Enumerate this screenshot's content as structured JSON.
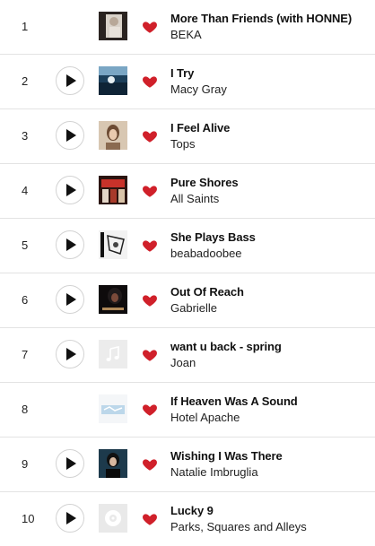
{
  "colors": {
    "heart": "#d0202a",
    "divider": "#e3e3e3",
    "text": "#111111"
  },
  "tracks": [
    {
      "rank": "1",
      "title": "More Than Friends (with HONNE)",
      "artist": "BEKA",
      "has_play": false,
      "art_icon": "album-art-icon"
    },
    {
      "rank": "2",
      "title": "I Try",
      "artist": "Macy Gray",
      "has_play": true,
      "art_icon": "album-art-icon"
    },
    {
      "rank": "3",
      "title": "I Feel Alive",
      "artist": "Tops",
      "has_play": true,
      "art_icon": "album-art-icon"
    },
    {
      "rank": "4",
      "title": "Pure Shores",
      "artist": "All Saints",
      "has_play": true,
      "art_icon": "album-art-icon"
    },
    {
      "rank": "5",
      "title": "She Plays Bass",
      "artist": "beabadoobee",
      "has_play": true,
      "art_icon": "album-art-icon"
    },
    {
      "rank": "6",
      "title": "Out Of Reach",
      "artist": "Gabrielle",
      "has_play": true,
      "art_icon": "album-art-icon"
    },
    {
      "rank": "7",
      "title": "want u back - spring",
      "artist": "Joan",
      "has_play": true,
      "art_icon": "music-note-placeholder-icon"
    },
    {
      "rank": "8",
      "title": "If Heaven Was A Sound",
      "artist": "Hotel Apache",
      "has_play": false,
      "art_icon": "album-art-icon"
    },
    {
      "rank": "9",
      "title": "Wishing I Was There",
      "artist": "Natalie Imbruglia",
      "has_play": true,
      "art_icon": "album-art-icon"
    },
    {
      "rank": "10",
      "title": "Lucky 9",
      "artist": "Parks, Squares and Alleys",
      "has_play": true,
      "art_icon": "album-art-icon"
    }
  ]
}
